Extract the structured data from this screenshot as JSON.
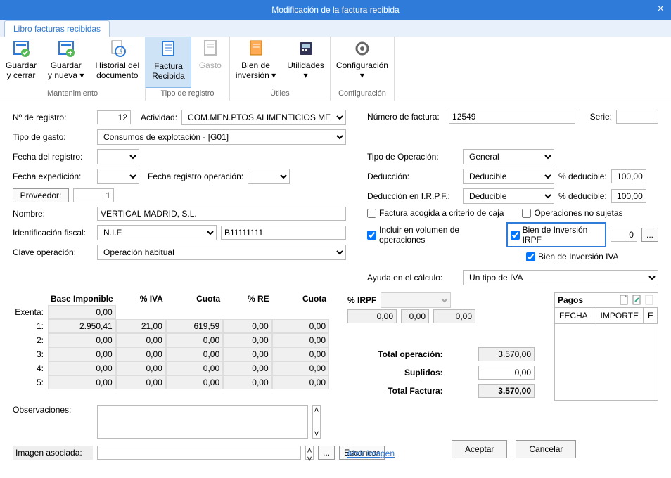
{
  "title": "Modificación de la factura recibida",
  "tab": "Libro facturas recibidas",
  "ribbon": {
    "groups": [
      {
        "label": "Mantenimiento",
        "items": [
          {
            "name": "guardar-cerrar",
            "label": "Guardar\ny cerrar"
          },
          {
            "name": "guardar-nueva",
            "label": "Guardar\ny nueva ▾"
          },
          {
            "name": "historial",
            "label": "Historial del\ndocumento"
          }
        ]
      },
      {
        "label": "Tipo de registro",
        "items": [
          {
            "name": "factura-recibida",
            "label": "Factura\nRecibida",
            "selected": true
          },
          {
            "name": "gasto",
            "label": "Gasto",
            "disabled": true
          }
        ]
      },
      {
        "label": "Útiles",
        "items": [
          {
            "name": "bien-inversion",
            "label": "Bien de\ninversión ▾"
          },
          {
            "name": "utilidades",
            "label": "Utilidades\n▾"
          }
        ]
      },
      {
        "label": "Configuración",
        "items": [
          {
            "name": "configuracion",
            "label": "Configuración\n▾"
          }
        ]
      }
    ]
  },
  "form": {
    "num_registro_lbl": "Nº de registro:",
    "num_registro": "12",
    "actividad_lbl": "Actividad:",
    "actividad": "COM.MEN.PTOS.ALIMENTICIOS ME",
    "tipo_gasto_lbl": "Tipo de gasto:",
    "tipo_gasto": "Consumos de explotación - [G01]",
    "fecha_registro_lbl": "Fecha del registro:",
    "fecha_registro": "",
    "fecha_exp_lbl": "Fecha expedición:",
    "fecha_exp": "",
    "fecha_reg_op_lbl": "Fecha registro operación:",
    "fecha_reg_op": "",
    "proveedor_btn": "Proveedor:",
    "proveedor": "1",
    "nombre_lbl": "Nombre:",
    "nombre": "VERTICAL MADRID, S.L.",
    "id_fiscal_lbl": "Identificación fiscal:",
    "id_fiscal_tipo": "N.I.F.",
    "id_fiscal": "B11111111",
    "clave_op_lbl": "Clave operación:",
    "clave_op": "Operación habitual",
    "num_factura_lbl": "Número de factura:",
    "num_factura": "12549",
    "serie_lbl": "Serie:",
    "serie": "",
    "tipo_operacion_lbl": "Tipo de Operación:",
    "tipo_operacion": "General",
    "deduccion_lbl": "Deducción:",
    "deduccion": "Deducible",
    "pct_deducible_lbl": "% deducible:",
    "pct_deducible": "100,00",
    "deduccion_irpf_lbl": "Deducción en I.R.P.F.:",
    "deduccion_irpf": "Deducible",
    "pct_deducible_irpf": "100,00",
    "factura_caja_lbl": "Factura acogida a criterio de caja",
    "op_no_sujetas_lbl": "Operaciones no sujetas",
    "incluir_vol_lbl": "Incluir en  volumen de operaciones",
    "bien_inv_irpf_lbl": "Bien de Inversión IRPF",
    "bien_inv_irpf_val": "0",
    "bien_inv_iva_lbl": "Bien de Inversión IVA",
    "ayuda_calculo_lbl": "Ayuda en el cálculo:",
    "ayuda_calculo": "Un tipo de IVA"
  },
  "iva": {
    "headers": {
      "base": "Base Imponible",
      "pct_iva": "% IVA",
      "cuota": "Cuota",
      "pct_re": "% RE",
      "cuota_re": "Cuota",
      "pct_irpf": "% IRPF"
    },
    "exenta_lbl": "Exenta:",
    "exenta": "0,00",
    "rows": [
      {
        "n": "1:",
        "base": "2.950,41",
        "piva": "21,00",
        "cuota": "619,59",
        "pre": "0,00",
        "cuotare": "0,00"
      },
      {
        "n": "2:",
        "base": "0,00",
        "piva": "0,00",
        "cuota": "0,00",
        "pre": "0,00",
        "cuotare": "0,00"
      },
      {
        "n": "3:",
        "base": "0,00",
        "piva": "0,00",
        "cuota": "0,00",
        "pre": "0,00",
        "cuotare": "0,00"
      },
      {
        "n": "4:",
        "base": "0,00",
        "piva": "0,00",
        "cuota": "0,00",
        "pre": "0,00",
        "cuotare": "0,00"
      },
      {
        "n": "5:",
        "base": "0,00",
        "piva": "0,00",
        "cuota": "0,00",
        "pre": "0,00",
        "cuotare": "0,00"
      }
    ],
    "irpf_base": "0,00",
    "irpf_pct": "0,00",
    "irpf_cuota": "0,00",
    "totals": {
      "total_op_lbl": "Total operación:",
      "total_op": "3.570,00",
      "suplidos_lbl": "Suplidos:",
      "suplidos": "0,00",
      "total_fac_lbl": "Total Factura:",
      "total_fac": "3.570,00"
    }
  },
  "pagos": {
    "title": "Pagos",
    "cols": {
      "fecha": "FECHA",
      "importe": "IMPORTE",
      "e": "E"
    }
  },
  "obs_lbl": "Observaciones:",
  "obs": "",
  "img_lbl": "Imagen asociada:",
  "img": "",
  "btns": {
    "dots": "...",
    "escanear": "Escanear",
    "abrir_imagen": "Abrir imagen",
    "aceptar": "Aceptar",
    "cancelar": "Cancelar"
  }
}
